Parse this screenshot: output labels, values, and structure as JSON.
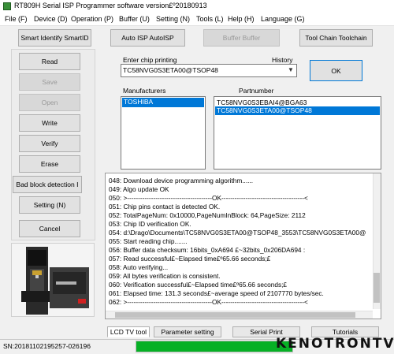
{
  "window": {
    "title": "RT809H Serial ISP Programmer software version£º20180913"
  },
  "menu": [
    {
      "label": "File (F)"
    },
    {
      "label": "Device (D)"
    },
    {
      "label": "Operation (P)"
    },
    {
      "label": "Buffer (U)"
    },
    {
      "label": "Setting (N)"
    },
    {
      "label": "Tools (L)"
    },
    {
      "label": "Help (H)"
    },
    {
      "label": "Language (G)"
    }
  ],
  "toolbar": {
    "smart_identify": "Smart Identify SmartID",
    "auto_isp": "Auto ISP AutoISP",
    "buffer": "Buffer Buffer",
    "tool_chain": "Tool Chain Toolchain"
  },
  "actions": {
    "read": "Read",
    "save": "Save",
    "open": "Open",
    "write": "Write",
    "verify": "Verify",
    "erase": "Erase",
    "bad_block": "Bad block detection I",
    "setting": "Setting (N)",
    "cancel": "Cancel"
  },
  "chip": {
    "enter_label": "Enter chip printing",
    "history_label": "History",
    "value": "TC58NVG0S3ETA00@TSOP48",
    "ok_label": "OK",
    "manufacturers_label": "Manufacturers",
    "manufacturers": [
      "TOSHIBA"
    ],
    "partnumber_label": "Partnumber",
    "partnumbers": [
      "TC58NVG0S3EBAI4@BGA63",
      "TC58NVG0S3ETA00@TSOP48"
    ]
  },
  "log": [
    "048:  Download device programming algorithm......",
    "049:  Algo update OK",
    "050:  >---------------------------------------OK--------------------------------------<",
    "051:  Chip pins contact is detected OK.",
    "052:  TotalPageNum: 0x10000,PageNumInBlock: 64,PageSize: 2112",
    "053:  Chip ID verification OK.",
    "054:  d:\\Drago\\Documents\\TC58NVG0S3ETA00@TSOP48_3553\\TC58NVG0S3ETA00@",
    "055:  Start reading chip.......",
    "056:  Buffer data checksum: 16bits_0xA694 £~32bits_0x206DA694 :",
    "057:  Read successful£~Elapsed time£º65.66 seconds;£",
    "058:  Auto verifying...",
    "059:  All bytes verification is consistent.",
    "060:  Verification successful£~Elapsed time£º65.66 seconds;£",
    "061:  Elapsed time: 131.3 seconds£~average speed of 2107770 bytes/sec.",
    "062:  >---------------------------------------OK--------------------------------------<"
  ],
  "tabs": [
    {
      "label": "LCD TV tool"
    },
    {
      "label": "Parameter setting"
    },
    {
      "label": "Serial Print"
    },
    {
      "label": "Tutorials"
    }
  ],
  "status": {
    "sn": "SN:20181102195257-026196",
    "progress": 1.0,
    "progress_color": "#06b025"
  },
  "watermark": "KENOTRONTV",
  "colors": {
    "selection": "#0078d7"
  }
}
